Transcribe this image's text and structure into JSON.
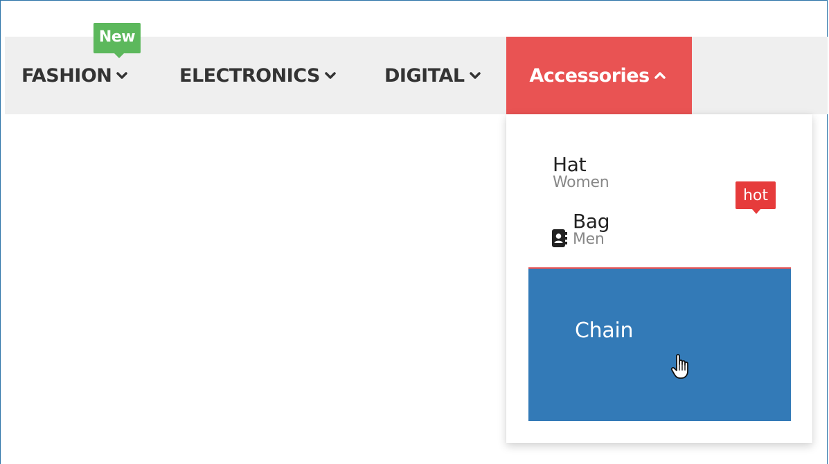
{
  "nav": {
    "items": [
      {
        "label": "FASHION",
        "chevron": "chevron-down-icon",
        "badge": "New",
        "badge_color": "#5cb85c"
      },
      {
        "label": "ELECTRONICS",
        "chevron": "chevron-down-icon"
      },
      {
        "label": "DIGITAL",
        "chevron": "chevron-down-icon"
      },
      {
        "label": "Accessories",
        "chevron": "chevron-up-icon",
        "active": true,
        "active_color": "#e95353"
      }
    ]
  },
  "dropdown": {
    "items": [
      {
        "title": "Hat",
        "subtitle": "Women"
      },
      {
        "title": "Bag",
        "subtitle": "Men",
        "icon": "contact-book-icon"
      },
      {
        "title": "Chain",
        "hovered": true,
        "hover_color": "#337ab7"
      }
    ],
    "hot_badge": "hot",
    "hot_badge_color": "#e63b3b"
  },
  "cursor": "pointer-hand-icon"
}
